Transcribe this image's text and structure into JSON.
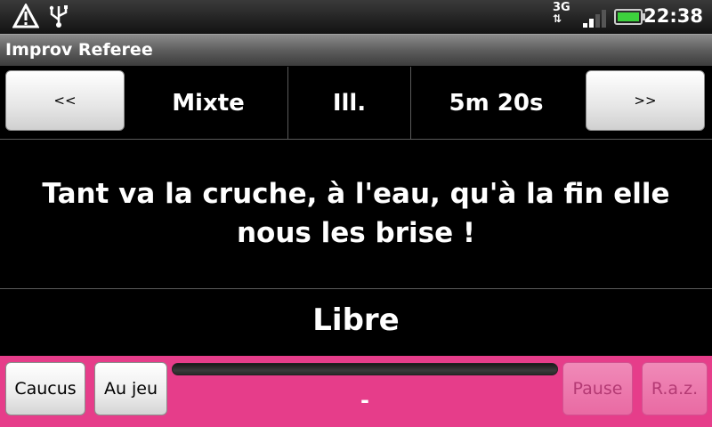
{
  "status_bar": {
    "time": "22:38",
    "network": "3G",
    "icons": [
      "warning-icon",
      "usb-icon",
      "network-3g-icon",
      "signal-icon",
      "battery-icon"
    ]
  },
  "app": {
    "title": "Improv Referee"
  },
  "match": {
    "prev_label": "<<",
    "next_label": ">>",
    "type": "Mixte",
    "players": "Ill.",
    "duration": "5m 20s"
  },
  "theme": "Tant va la cruche, à l'eau, qu'à la fin elle nous les brise !",
  "category": "Libre",
  "controls": {
    "caucus_label": "Caucus",
    "play_label": "Au jeu",
    "pause_label": "Pause",
    "reset_label": "R.a.z.",
    "timer_text": "-",
    "progress": 0
  },
  "colors": {
    "accent": "#e63d8a",
    "background": "#000000"
  }
}
